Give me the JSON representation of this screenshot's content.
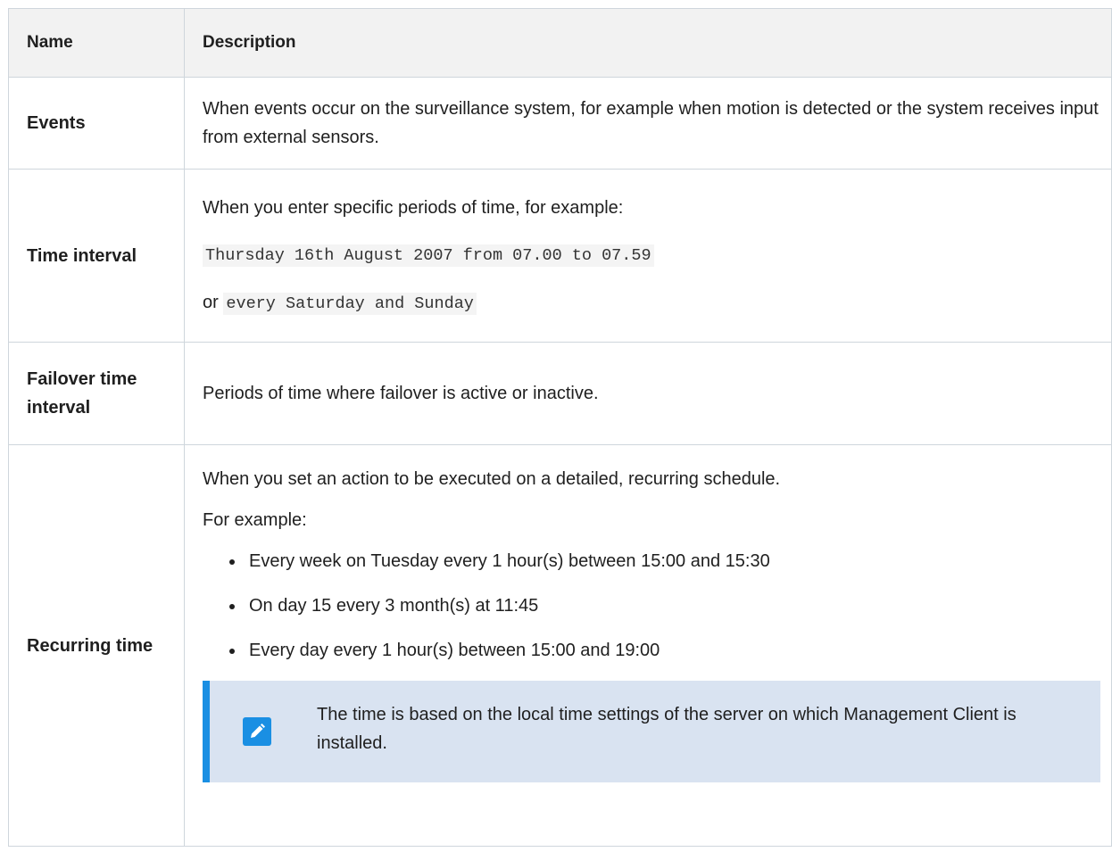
{
  "table": {
    "header": {
      "name": "Name",
      "description": "Description"
    },
    "rows": {
      "events": {
        "name": "Events",
        "description": "When events occur on the surveillance system, for example when motion is detected or the system receives input from external sensors."
      },
      "time_interval": {
        "name": "Time interval",
        "intro": "When you enter specific periods of time, for example:",
        "example1": "Thursday 16th August 2007 from 07.00 to 07.59",
        "or_label": "or",
        "example2": "every Saturday and Sunday"
      },
      "failover": {
        "name": "Failover time interval",
        "description": "Periods of time where failover is active or inactive."
      },
      "recurring": {
        "name": "Recurring time",
        "intro": "When you set an action to be executed on a detailed, recurring schedule.",
        "for_example": "For example:",
        "bullets": [
          "Every week on Tuesday every 1 hour(s) between 15:00 and 15:30",
          "On day 15 every 3 month(s) at 11:45",
          "Every day every 1 hour(s) between 15:00 and 19:00"
        ],
        "note": "The time is based on the local time settings of the server on which Management Client is installed."
      }
    }
  },
  "colors": {
    "note_background": "#d9e3f1",
    "note_accent": "#1a8fe3",
    "header_background": "#f2f2f2",
    "border": "#cfd6dc"
  },
  "icons": {
    "note_icon": "pencil-icon"
  }
}
